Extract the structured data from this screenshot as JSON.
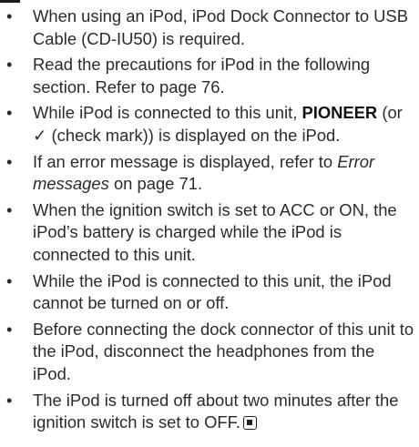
{
  "page": {
    "notes": [
      {
        "text": "When using an iPod, iPod Dock Connector to USB Cable (CD-IU50) is required."
      },
      {
        "text": "Read the precautions for iPod in the following section. Refer to page 76."
      },
      {
        "pre": "While iPod is connected to this unit, ",
        "bold": "PIONEER",
        "post": " (or ✓ (check mark)) is displayed on the iPod."
      },
      {
        "pre": "If an error message is displayed, refer to ",
        "italic": "Error messages",
        "post": " on page 71."
      },
      {
        "text": "When the ignition switch is set to ACC or ON, the iPod’s battery is charged while the iPod is connected to this unit."
      },
      {
        "text": "While the iPod is connected to this unit, the iPod cannot be turned on or off."
      },
      {
        "text": "Before connecting the dock connector of this unit to the iPod, disconnect the headphones from the iPod."
      },
      {
        "text": "The iPod is turned off about two minutes after the ignition switch is set to OFF."
      }
    ],
    "bullet_glyph": "•",
    "end_mark_icon": "end-of-section-icon"
  }
}
